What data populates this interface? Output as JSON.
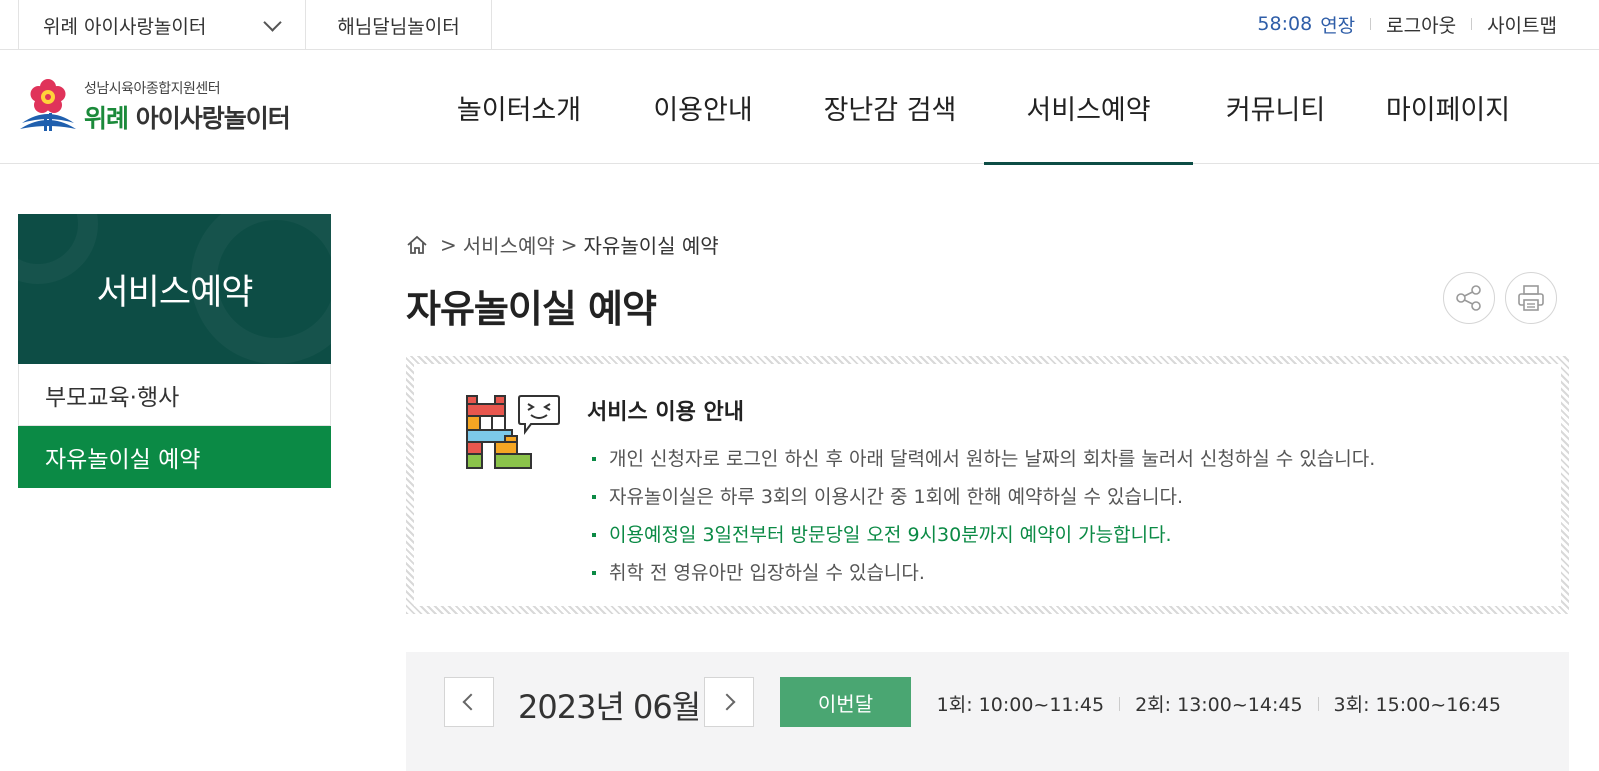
{
  "topbar": {
    "site_select": "위례 아이사랑놀이터",
    "site_link": "해님달님놀이터",
    "timer": "58:08",
    "extend": "연장",
    "logout": "로그아웃",
    "sitemap": "사이트맵"
  },
  "logo": {
    "sub": "성남시육아종합지원센터",
    "main_green": "위례",
    "main": "아이사랑놀이터"
  },
  "gnb": [
    "놀이터소개",
    "이용안내",
    "장난감 검색",
    "서비스예약",
    "커뮤니티",
    "마이페이지"
  ],
  "lnb": {
    "title": "서비스예약",
    "items": [
      "부모교육·행사",
      "자유놀이실 예약"
    ]
  },
  "breadcrumb": {
    "sep": ">",
    "level1": "서비스예약",
    "current": "자유놀이실 예약"
  },
  "page_title": "자유놀이실 예약",
  "notice": {
    "title": "서비스 이용 안내",
    "items": [
      "개인 신청자로 로그인 하신 후 아래 달력에서 원하는 날짜의 회차를 눌러서 신청하실 수 있습니다.",
      "자유놀이실은 하루 3회의 이용시간 중 1회에 한해 예약하실 수 있습니다.",
      "이용예정일 3일전부터 방문당일 오전 9시30분까지 예약이 가능합니다.",
      "취학 전 영유아만 입장하실 수 있습니다."
    ]
  },
  "calendar": {
    "month": "2023년 06월",
    "this_month": "이번달",
    "sessions": [
      "1회: 10:00~11:45",
      "2회: 13:00~14:45",
      "3회: 15:00~16:45"
    ]
  },
  "icons": {
    "home": "home-icon",
    "share": "share-icon",
    "print": "print-icon",
    "prev": "chevron-left-icon",
    "next": "chevron-right-icon",
    "dropdown": "chevron-down-icon"
  },
  "colors": {
    "brand_dark": "#0d4d45",
    "brand_green": "#0b8a45",
    "button_green": "#4aa672",
    "timer_blue": "#2f5ea8"
  }
}
